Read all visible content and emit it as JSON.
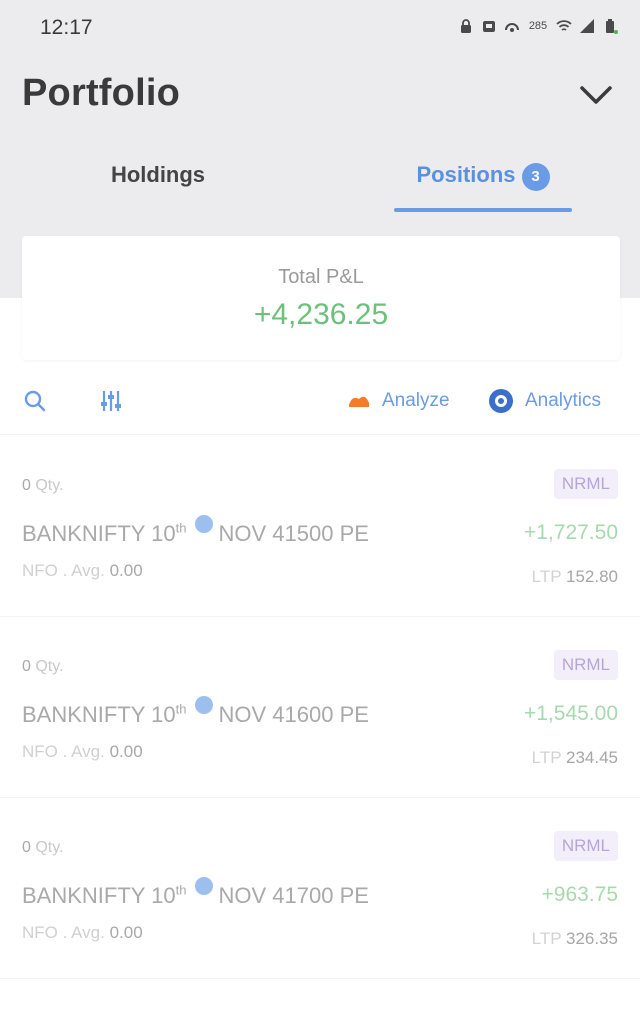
{
  "status_bar": {
    "time": "12:17",
    "icons": [
      "lock-icon",
      "notification-icon",
      "hotspot-icon",
      "data-speed-icon",
      "wifi-icon",
      "signal-icon",
      "battery-icon"
    ],
    "data_speed_text": "285",
    "battery_color": "#4caf50"
  },
  "header": {
    "title": "Portfolio",
    "menu_icon": "chevron-down-icon"
  },
  "tabs": [
    {
      "label": "Holdings",
      "active": false
    },
    {
      "label": "Positions",
      "badge": "3",
      "active": true
    }
  ],
  "summary": {
    "label": "Total P&L",
    "value": "+4,236.25",
    "value_color": "#6cc07a"
  },
  "toolbar": {
    "search_icon": "search-icon",
    "filter_icon": "filter-icon",
    "analyze_label": "Analyze",
    "analyze_icon": "sensibull-icon",
    "analytics_label": "Analytics",
    "analytics_icon": "analytics-icon"
  },
  "positions": [
    {
      "qty": "0",
      "qty_label": "Qty.",
      "symbol": "BANKNIFTY 10",
      "date_suffix": "th",
      "expiry": "NOV 41500 PE",
      "exchange": "NFO",
      "avg_label": "Avg.",
      "avg": "0.00",
      "product": "NRML",
      "pnl": "+1,727.50",
      "ltp_label": "LTP",
      "ltp": "152.80"
    },
    {
      "qty": "0",
      "qty_label": "Qty.",
      "symbol": "BANKNIFTY 10",
      "date_suffix": "th",
      "expiry": "NOV 41600 PE",
      "exchange": "NFO",
      "avg_label": "Avg.",
      "avg": "0.00",
      "product": "NRML",
      "pnl": "+1,545.00",
      "ltp_label": "LTP",
      "ltp": "234.45"
    },
    {
      "qty": "0",
      "qty_label": "Qty.",
      "symbol": "BANKNIFTY 10",
      "date_suffix": "th",
      "expiry": "NOV 41700 PE",
      "exchange": "NFO",
      "avg_label": "Avg.",
      "avg": "0.00",
      "product": "NRML",
      "pnl": "+963.75",
      "ltp_label": "LTP",
      "ltp": "326.35"
    }
  ],
  "colors": {
    "accent": "#6a9be6",
    "profit": "#6cc07a",
    "product_badge_bg": "#f3effa",
    "product_badge_text": "#b7a5d6",
    "analyze_icon": "#f07c2c"
  }
}
